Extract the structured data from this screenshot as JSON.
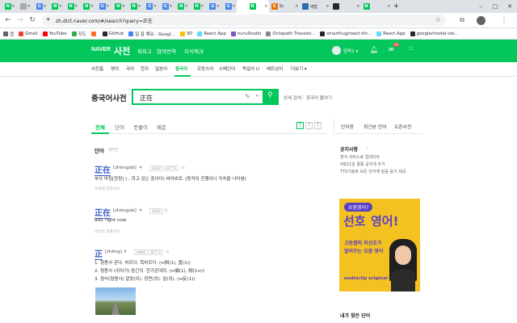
{
  "browser": {
    "tabs": [
      {
        "fav": "N",
        "color": "#03c75a"
      },
      {
        "fav": "",
        "color": "#aaa"
      },
      {
        "fav": "G",
        "color": "#4285f4"
      },
      {
        "fav": "N",
        "color": "#03c75a"
      },
      {
        "fav": "N",
        "color": "#03c75a"
      },
      {
        "fav": "N",
        "color": "#03c75a"
      },
      {
        "fav": "G",
        "color": "#4285f4"
      },
      {
        "fav": "N",
        "color": "#03c75a"
      },
      {
        "fav": "N",
        "color": "#03c75a"
      },
      {
        "fav": "G",
        "color": "#4285f4"
      },
      {
        "fav": "G",
        "color": "#4285f4"
      },
      {
        "fav": "N",
        "color": "#03c75a"
      },
      {
        "fav": "N",
        "color": "#03c75a"
      },
      {
        "fav": "G",
        "color": "#4285f4"
      },
      {
        "fav": "G",
        "color": "#4285f4"
      }
    ],
    "active_tab": {
      "fav": "N",
      "color": "#03c75a"
    },
    "tail_tabs": [
      {
        "fav": "S",
        "color": "#e8710a",
        "label": "Sc"
      },
      {
        "fav": "",
        "color": "#2b6cb0",
        "label": "새탭"
      },
      {
        "fav": "",
        "color": "#24292e",
        "label": ""
      },
      {
        "fav": "N",
        "color": "#03c75a",
        "label": ""
      }
    ],
    "new_tab": "+",
    "window_controls": {
      "minimize": "–",
      "maximize": "□",
      "close": "✕"
    },
    "url": "zh.dict.naver.com/#/search?query=正在",
    "bookmarks": [
      {
        "label": "앱",
        "color": "#5f6368"
      },
      {
        "label": "Gmail",
        "color": "#ea4335"
      },
      {
        "label": "YouTube",
        "color": "#ff0000"
      },
      {
        "label": "지도",
        "color": "#34a853"
      },
      {
        "label": "",
        "color": "#fc6d26"
      },
      {
        "label": "GitHub",
        "color": "#24292e"
      },
      {
        "label": "일 잘 해요 - Googl...",
        "color": "#4285f4"
      },
      {
        "label": "3D",
        "color": "#fbbc04"
      },
      {
        "label": "React App",
        "color": "#61dafb"
      },
      {
        "label": "nuruStudio",
        "color": "#7e57c2"
      },
      {
        "label": "Octopath Traveler...",
        "color": "#888"
      },
      {
        "label": "smarthug/react-thr...",
        "color": "#24292e"
      },
      {
        "label": "React App",
        "color": "#61dafb"
      },
      {
        "label": "google/model-vie...",
        "color": "#24292e"
      }
    ]
  },
  "naver": {
    "logo": "NAVER",
    "service": "사전",
    "nav": [
      "파파고",
      "참여번역",
      "지식백과"
    ],
    "user": "링퍼1 ▾",
    "mail_badge": "99",
    "menu": [
      "사전홈",
      "영어",
      "국어",
      "한자",
      "일본어",
      "중국어",
      "프랑스어",
      "스페인어",
      "독일어 U",
      "베트남어",
      "더보기 ▾"
    ],
    "active_menu_index": 5
  },
  "search": {
    "dict_title": "중국어사전",
    "query": "正在",
    "links": [
      "상세 검색",
      "중국어 붙여기"
    ]
  },
  "results": {
    "filters": [
      "전체",
      "단어",
      "뜻풀이",
      "예문"
    ],
    "size_buttons": [
      "T",
      "T",
      "T"
    ],
    "section_title": "단어",
    "section_count": "87건",
    "entries": [
      {
        "word": "正在",
        "pinyin": "[zhèngzài]",
        "tags": [
          "HSK2",
          "BCT A"
        ],
        "lines": [
          "부사 마침[한창] (…하고 있는 중이다) 바야흐로. [동작의 진행이나 지속을 나타냄]"
        ],
        "source": "고려대 중한사전"
      },
      {
        "word": "正在",
        "pinyin": "[zhèngzài]",
        "tags": [
          "HSK2"
        ],
        "lines": [
          "adv. right now"
        ],
        "source": "라인의 중영사전"
      },
      {
        "word": "正",
        "pinyin": "[zhēng]",
        "tags": [
          "HSK6",
          "BCT B"
        ],
        "lines": [
          "1. 형용사 곧다. 바르다. 똑바르다. (↔斜(1), 歪(1))",
          "2. 형용사 (위치가) 중간의. 한가운데의. (↔偏(1), 侧(1↔))",
          "3. 형식(형용사) 알맞(이). 정면(의). 앞(의). (↔反(1))"
        ],
        "source": ""
      }
    ]
  },
  "sidebar": {
    "tabs": [
      "단어장",
      "최근본 단어",
      "오픈사전"
    ],
    "notice_title": "공지사항",
    "notices": [
      "영식 서비스로 업데이트",
      "4월21일 종종 공지게 추가",
      "TTS기술로 모든 단어에 발음 듣기 제공"
    ],
    "ad": {
      "bubble": "요즘영어?",
      "headline1": "선호",
      "headline2": "영어!",
      "sub1": "고등랩퍼 하선호가",
      "sub2": "알려주는 요즘 영어",
      "brand": "audioclip original"
    },
    "section2_title": "내가 찾은 단어"
  },
  "colors": {
    "naver_green": "#03c75a",
    "link_blue": "#3b5ec6",
    "ad_bg": "#f4c220",
    "ad_purple": "#5a3ec8"
  }
}
